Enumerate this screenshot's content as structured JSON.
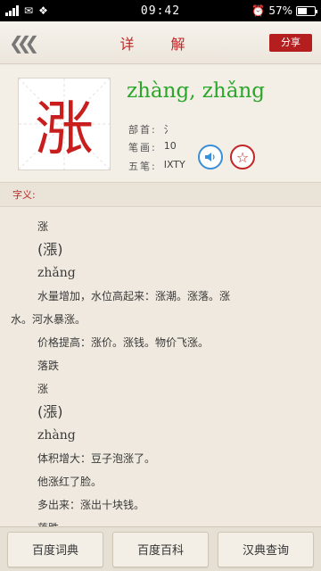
{
  "status_bar": {
    "time": "09:42",
    "battery": "57%",
    "battery_level": 0.57
  },
  "header": {
    "back_icon": "chevron-left-triple-icon",
    "title": "详 解",
    "share_label": "分享"
  },
  "character": {
    "glyph": "涨",
    "pinyin": "zhàng, zhǎng",
    "radical_label": "部首:",
    "radical_value": "氵",
    "strokes_label": "笔画:",
    "strokes_value": "10",
    "wubi_label": "五笔:",
    "wubi_value": "IXTY"
  },
  "section": {
    "label": "字义:"
  },
  "definition_lines": [
    {
      "text": "涨",
      "kind": "plain"
    },
    {
      "text": "(漲)",
      "kind": "trad"
    },
    {
      "text": "zhǎng",
      "kind": "py"
    },
    {
      "text": "水量增加，水位高起来：涨潮。涨落。涨",
      "kind": "plain"
    },
    {
      "text": "水。河水暴涨。",
      "kind": "indent"
    },
    {
      "text": "价格提高：涨价。涨钱。物价飞涨。",
      "kind": "plain"
    },
    {
      "text": "落跌",
      "kind": "plain"
    },
    {
      "text": "涨",
      "kind": "plain"
    },
    {
      "text": "(漲)",
      "kind": "trad"
    },
    {
      "text": "zhàng",
      "kind": "py"
    },
    {
      "text": "体积增大：豆子泡涨了。",
      "kind": "plain"
    },
    {
      "text": "他涨红了脸。",
      "kind": "plain"
    },
    {
      "text": "多出来：涨出十块钱。",
      "kind": "plain"
    },
    {
      "text": "落跌",
      "kind": "plain"
    }
  ],
  "bottom_buttons": [
    {
      "label": "百度词典"
    },
    {
      "label": "百度百科"
    },
    {
      "label": "汉典查询"
    }
  ]
}
